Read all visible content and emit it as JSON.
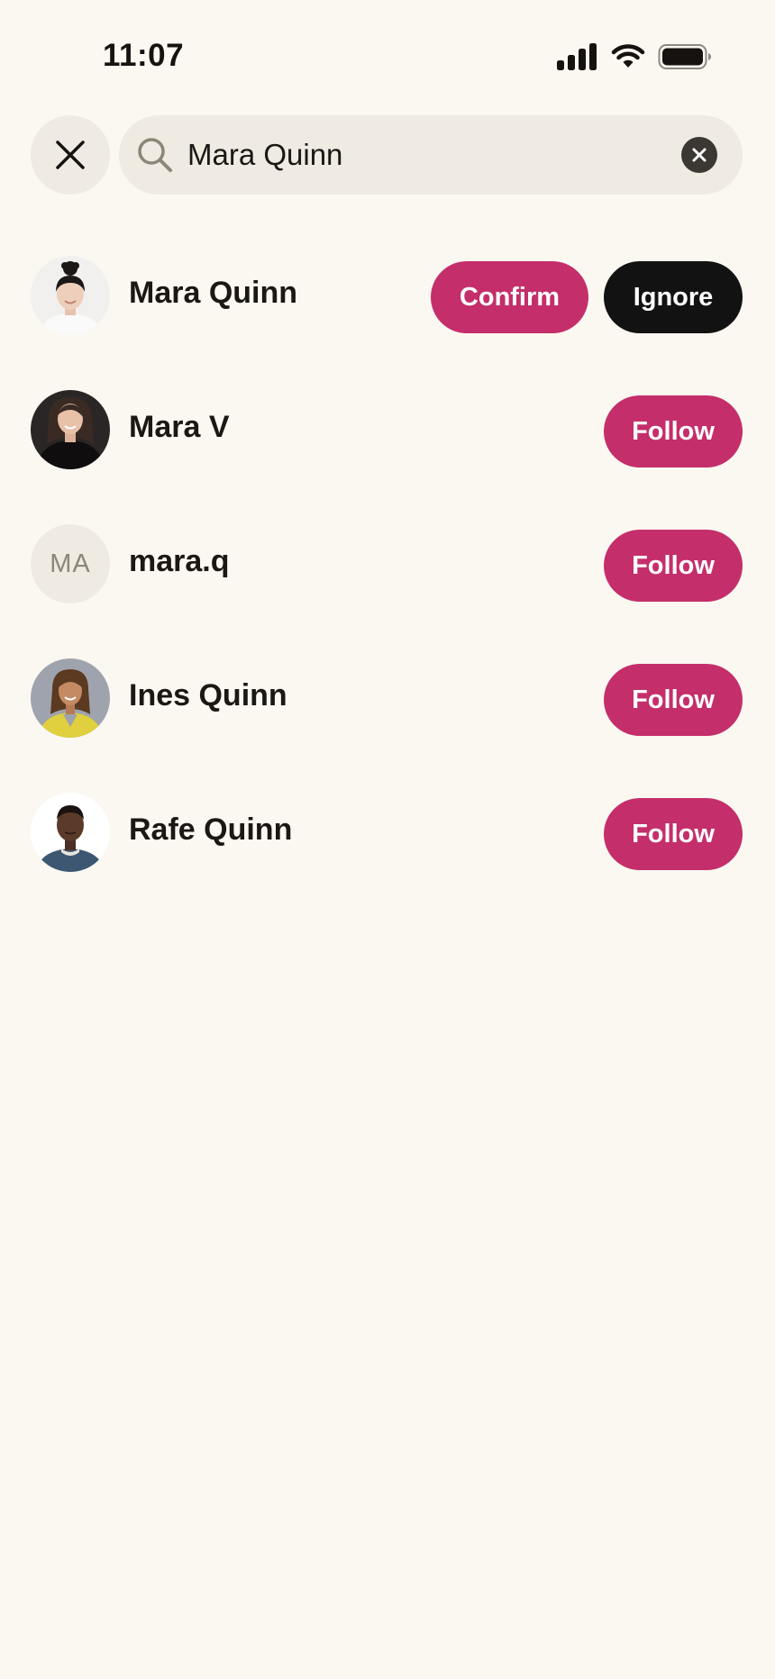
{
  "status_bar": {
    "time": "11:07",
    "icons": [
      "cellular-signal-icon",
      "wifi-icon",
      "battery-icon"
    ]
  },
  "search": {
    "query": "Mara Quinn",
    "close_icon": "close-icon",
    "search_icon": "search-icon",
    "clear_icon": "clear-icon"
  },
  "results": [
    {
      "name": "Mara Quinn",
      "avatar": "photo",
      "actions": [
        "Confirm",
        "Ignore"
      ]
    },
    {
      "name": "Mara V",
      "avatar": "photo",
      "actions": [
        "Follow"
      ]
    },
    {
      "name": "mara.q",
      "avatar_initials": "MA",
      "actions": [
        "Follow"
      ]
    },
    {
      "name": "Ines Quinn",
      "avatar": "photo",
      "actions": [
        "Follow"
      ]
    },
    {
      "name": "Rafe Quinn",
      "avatar": "photo",
      "actions": [
        "Follow"
      ]
    }
  ],
  "colors": {
    "background": "#fbf8f1",
    "accent": "#c42e6a",
    "dark_button": "#131212",
    "field": "#efebe3"
  }
}
